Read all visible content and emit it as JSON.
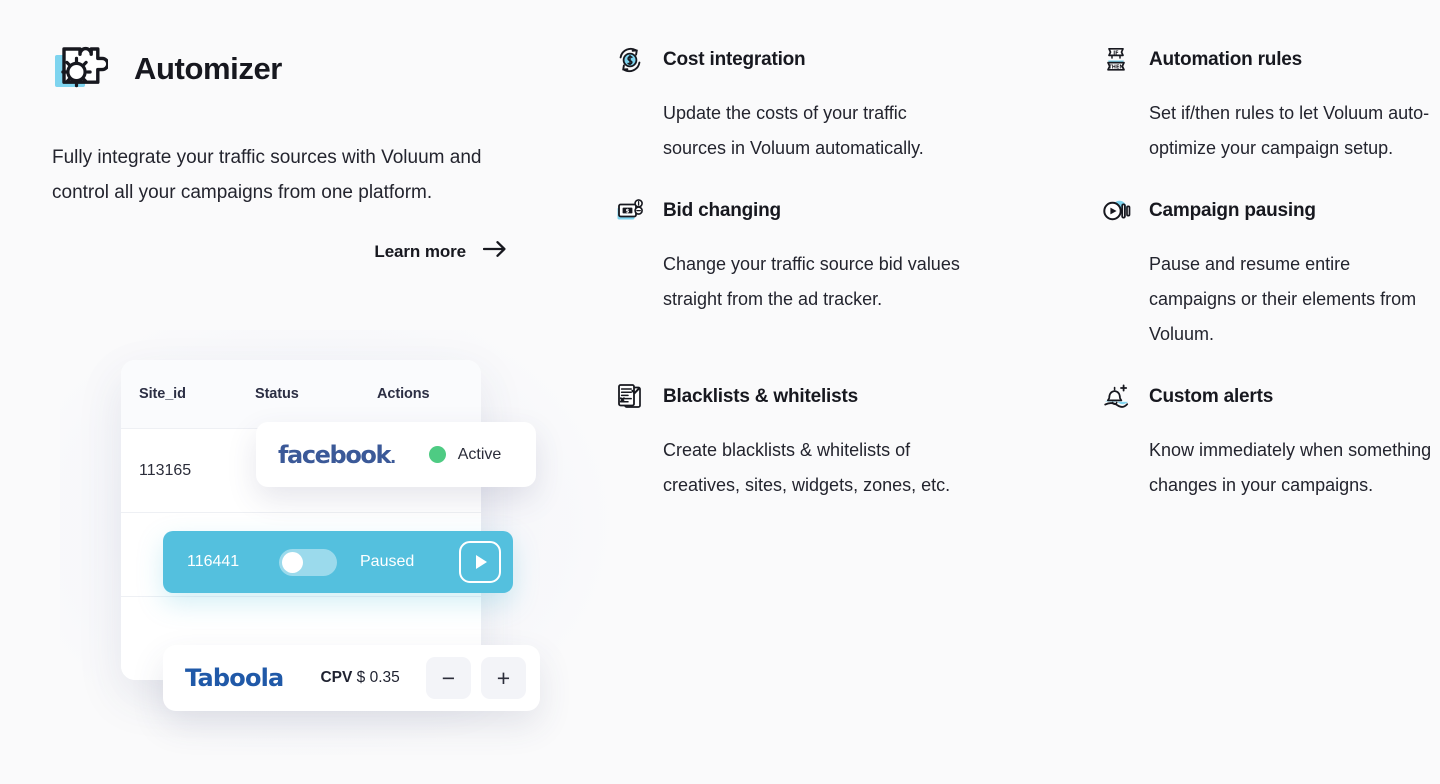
{
  "brand": {
    "title": "Automizer",
    "logo_icon": "puzzle-gear-icon",
    "accent_blue": "#7ed4ef",
    "accent_dark": "#17181f"
  },
  "lead": "Fully integrate your traffic sources with Voluum and control all your campaigns from one platform.",
  "learn_more": {
    "label": "Learn more",
    "icon": "arrow-right-icon"
  },
  "mockup": {
    "table": {
      "columns": [
        "Site_id",
        "Status",
        "Actions"
      ],
      "rows": [
        {
          "site_id": "113165"
        },
        {
          "site_id": "116441"
        },
        {
          "site_id": ""
        }
      ]
    },
    "facebook_card": {
      "brand": "facebook",
      "brand_dot": ".",
      "status_label": "Active",
      "status_color": "#4ecb83",
      "status_icon": "status-dot-icon"
    },
    "paused_row": {
      "site_id": "116441",
      "status_label": "Paused",
      "toggle_state": "off",
      "action_icon": "play-icon",
      "background_color": "#54c0de"
    },
    "taboola_card": {
      "brand": "Taboola",
      "metric_label": "CPV",
      "metric_value": "$ 0.35",
      "decrement_label": "−",
      "increment_label": "+",
      "decrement_icon": "minus-icon",
      "increment_icon": "plus-icon"
    }
  },
  "features": {
    "left": [
      {
        "icon": "cost-refresh-icon",
        "title": "Cost integration",
        "body": "Update the costs of your traffic sources in Voluum automatically."
      },
      {
        "icon": "banknote-coins-icon",
        "title": "Bid changing",
        "body": "Change your traffic source bid values straight from the ad tracker."
      },
      {
        "icon": "checklist-document-icon",
        "title": "Blacklists & whitelists",
        "body": "Create blacklists & whitelists of creatives, sites, widgets, zones, etc."
      }
    ],
    "right": [
      {
        "icon": "if-then-banner-icon",
        "title": "Automation rules",
        "body": "Set if/then rules to let Voluum auto-optimize your campaign setup."
      },
      {
        "icon": "play-pause-icon",
        "title": "Campaign pausing",
        "body": "Pause and resume entire campaigns or their elements from Voluum."
      },
      {
        "icon": "bell-plus-icon",
        "title": "Custom alerts",
        "body": "Know immediately when something changes in your campaigns."
      }
    ]
  }
}
